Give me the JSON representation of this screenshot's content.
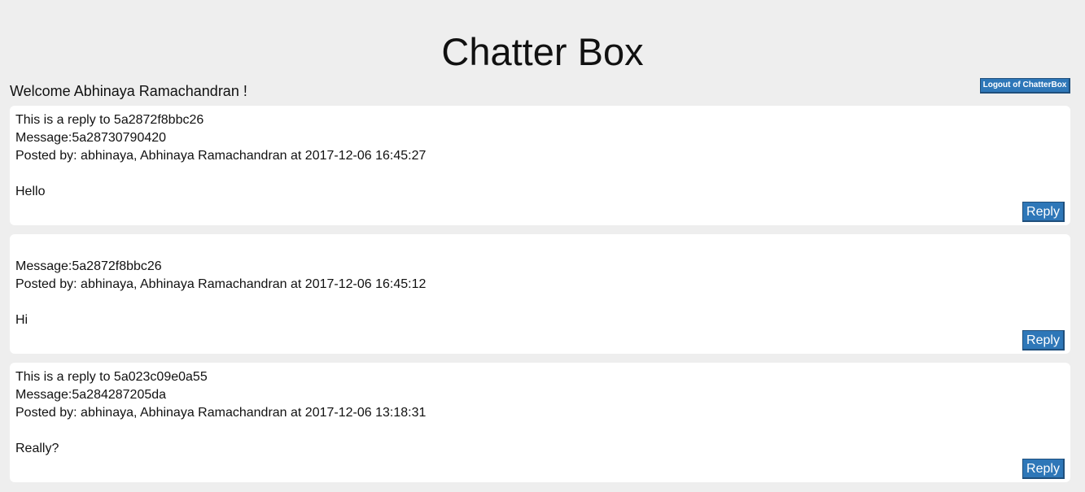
{
  "header": {
    "title": "Chatter Box",
    "welcome": "Welcome Abhinaya Ramachandran !",
    "logout_label": "Logout of ChatterBox"
  },
  "messages": [
    {
      "reply_to": "This is a reply to 5a2872f8bbc26",
      "message_id": "Message:5a28730790420",
      "posted_by": "Posted by: abhinaya, Abhinaya Ramachandran at 2017-12-06 16:45:27",
      "body": "Hello",
      "reply_label": "Reply"
    },
    {
      "reply_to": "",
      "message_id": "Message:5a2872f8bbc26",
      "posted_by": "Posted by: abhinaya, Abhinaya Ramachandran at 2017-12-06 16:45:12",
      "body": "Hi",
      "reply_label": "Reply"
    },
    {
      "reply_to": "This is a reply to 5a023c09e0a55",
      "message_id": "Message:5a284287205da",
      "posted_by": "Posted by: abhinaya, Abhinaya Ramachandran at 2017-12-06 13:18:31",
      "body": "Really?",
      "reply_label": "Reply"
    }
  ],
  "colors": {
    "background": "#eeeeee",
    "card": "#ffffff",
    "button": "#2e77b8"
  }
}
